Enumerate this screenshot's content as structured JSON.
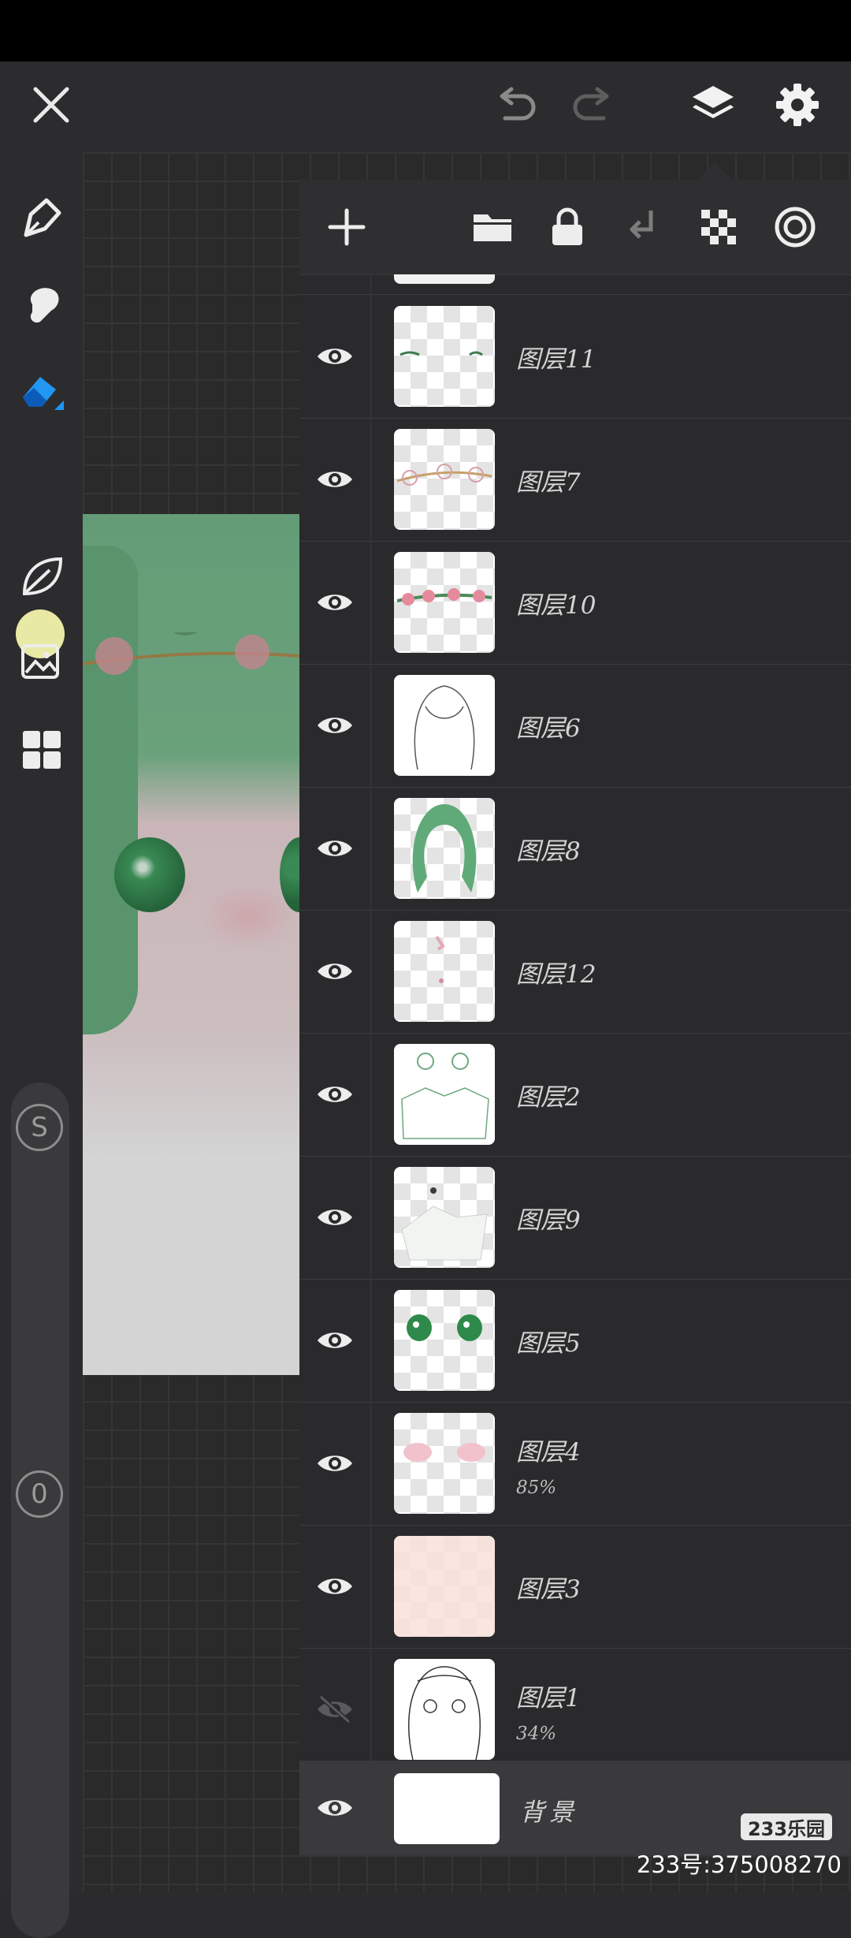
{
  "layers": [
    {
      "name": "图层11",
      "opacity": "",
      "visible": true
    },
    {
      "name": "图层7",
      "opacity": "",
      "visible": true
    },
    {
      "name": "图层10",
      "opacity": "",
      "visible": true
    },
    {
      "name": "图层6",
      "opacity": "",
      "visible": true
    },
    {
      "name": "图层8",
      "opacity": "",
      "visible": true
    },
    {
      "name": "图层12",
      "opacity": "",
      "visible": true
    },
    {
      "name": "图层2",
      "opacity": "",
      "visible": true
    },
    {
      "name": "图层9",
      "opacity": "",
      "visible": true
    },
    {
      "name": "图层5",
      "opacity": "",
      "visible": true
    },
    {
      "name": "图层4",
      "opacity": "85%",
      "visible": true
    },
    {
      "name": "图层3",
      "opacity": "",
      "visible": true
    },
    {
      "name": "图层1",
      "opacity": "34%",
      "visible": false
    },
    {
      "name": "背景",
      "opacity": "",
      "visible": true
    }
  ],
  "left_toolbar": {
    "size_badge": "S",
    "opacity_badge": "0",
    "current_color": "#e9e9a6"
  },
  "icons": {
    "close": "close-icon",
    "undo": "undo-icon",
    "redo": "redo-icon",
    "layers": "layers-icon",
    "settings": "gear-icon",
    "pen": "pen-icon",
    "smudge": "smudge-icon",
    "eraser": "eraser-icon",
    "leaf": "leaf-icon",
    "image": "image-icon",
    "grid": "grid-icon",
    "add": "plus-icon",
    "folder": "folder-icon",
    "lock": "lock-icon",
    "merge_down": "merge-down-icon",
    "transparency": "checkerboard-icon",
    "target": "target-icon"
  },
  "accent_color": "#2196f3",
  "watermark": {
    "logo": "233乐园",
    "id_text": "233号:375008270"
  }
}
